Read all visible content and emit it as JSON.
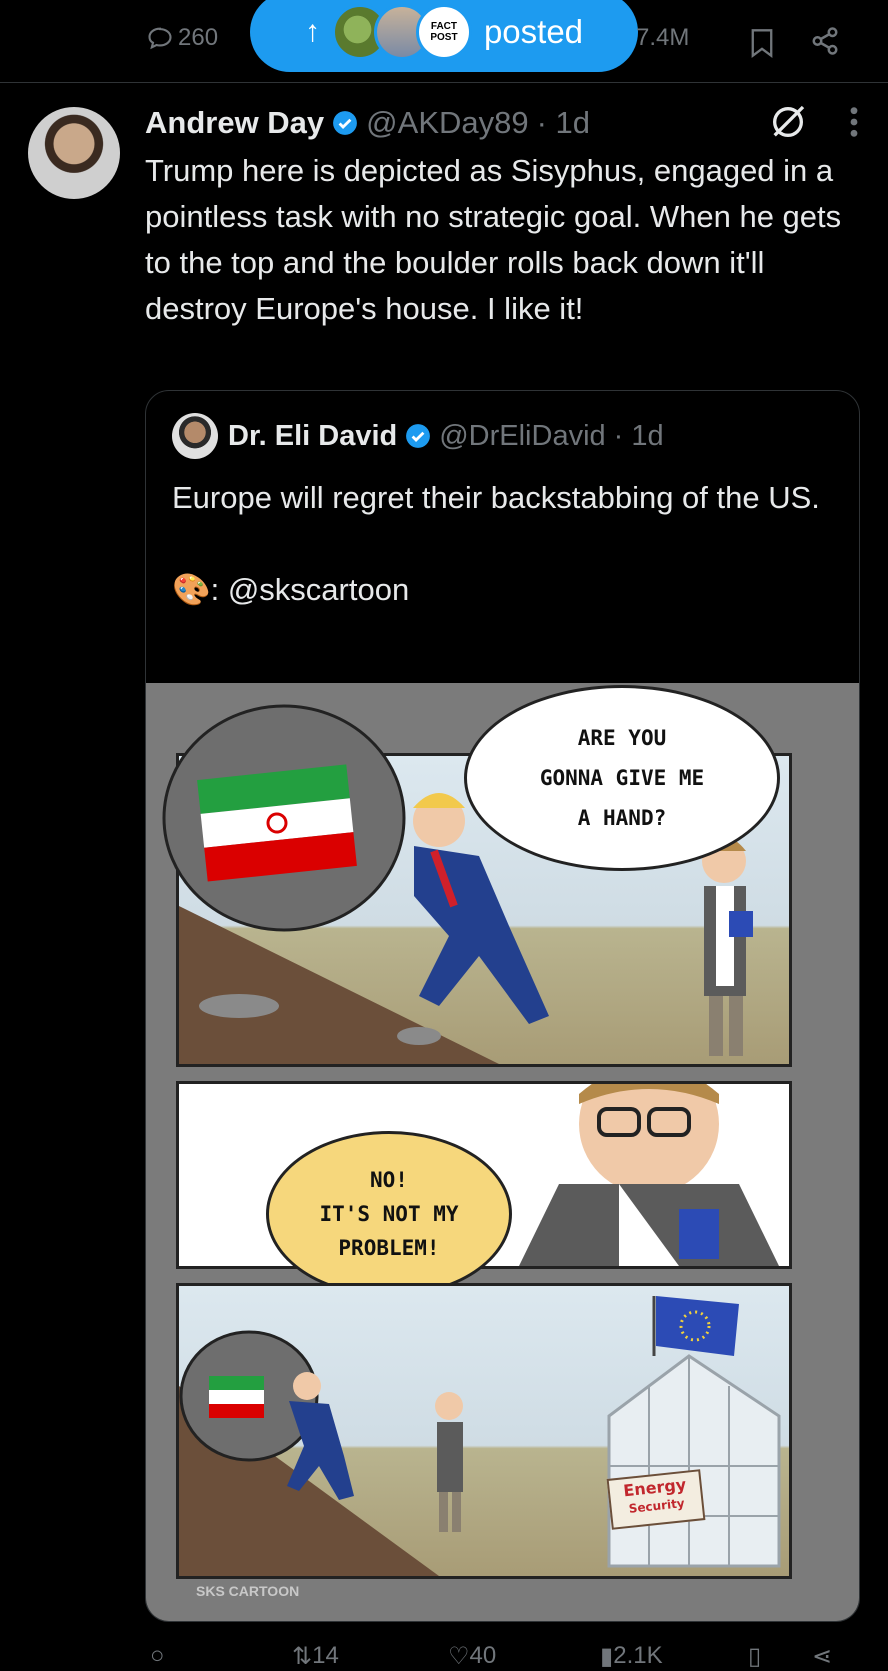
{
  "top_stats": {
    "replies": "260",
    "views": "7.4M"
  },
  "posted_pill": {
    "label": "posted",
    "arrow": "↑",
    "badge_text": "FACT POST"
  },
  "tweet": {
    "name": "Andrew Day",
    "handle": "@AKDay89",
    "time": "· 1d",
    "text": "Trump here is depicted as Sisyphus, engaged in a pointless task with no strategic goal. When he gets to the top and the boulder rolls back down it'll destroy Europe's house. I like it!"
  },
  "quote": {
    "name": "Dr. Eli David",
    "handle": "@DrEliDavid",
    "time": "· 1d",
    "text_line1": "Europe will regret their backstabbing of the US.",
    "credit": ": @skscartoon"
  },
  "cartoon": {
    "bubble1": [
      "ARE YOU",
      "GONNA GIVE ME",
      "A HAND?"
    ],
    "bubble2": [
      "NO!",
      "IT'S NOT MY",
      "PROBLEM!"
    ],
    "sign": [
      "Energy",
      "Security"
    ],
    "watermark": "SKS CARTOON"
  },
  "actions": {
    "retweets": "14",
    "likes": "40",
    "views": "2.1K"
  },
  "colors": {
    "accent": "#1d9bf0",
    "muted": "#71767b",
    "flag_green": "#239f40",
    "flag_red": "#da0000",
    "eu_blue": "#2c4bb5"
  }
}
